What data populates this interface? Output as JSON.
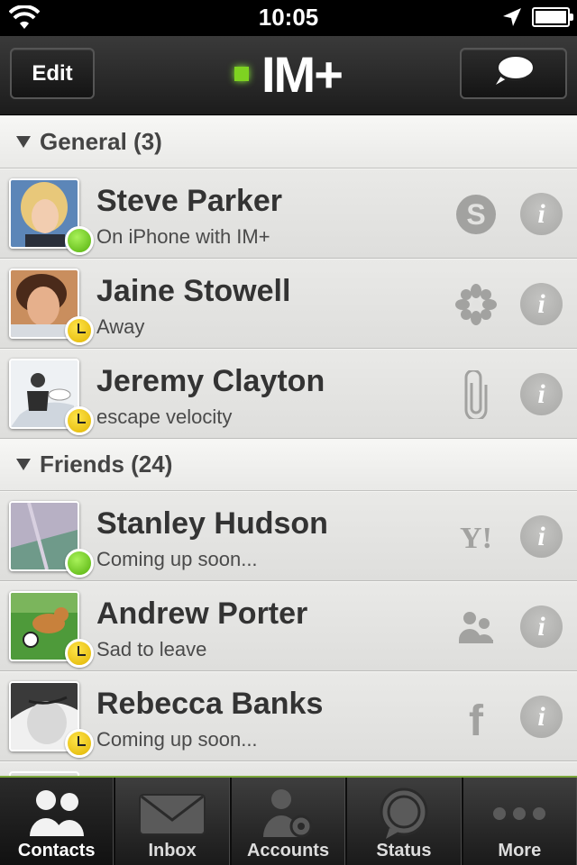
{
  "status_bar": {
    "time": "10:05",
    "icons": [
      "wifi-icon",
      "location-arrow-icon",
      "battery-icon"
    ]
  },
  "nav": {
    "edit_label": "Edit",
    "title": "IM+",
    "compose_icon": "speech-bubble-icon",
    "online_color": "#7ed321"
  },
  "groups": [
    {
      "header": "General (3)",
      "contacts": [
        {
          "name": "Steve Parker",
          "status": "On iPhone with IM+",
          "presence": "online",
          "service": "skype-icon"
        },
        {
          "name": "Jaine Stowell",
          "status": "Away",
          "presence": "away",
          "service": "icq-flower-icon"
        },
        {
          "name": "Jeremy Clayton",
          "status": "escape velocity",
          "presence": "away",
          "service": "paperclip-icon"
        }
      ]
    },
    {
      "header": "Friends (24)",
      "contacts": [
        {
          "name": "Stanley Hudson",
          "status": "Coming up soon...",
          "presence": "online",
          "service": "yahoo-icon"
        },
        {
          "name": "Andrew Porter",
          "status": "Sad to leave",
          "presence": "away",
          "service": "people-group-icon"
        },
        {
          "name": "Rebecca Banks",
          "status": "Coming up soon...",
          "presence": "away",
          "service": "facebook-icon"
        }
      ]
    }
  ],
  "tabs": [
    {
      "label": "Contacts",
      "icon": "contacts-icon",
      "active": true
    },
    {
      "label": "Inbox",
      "icon": "envelope-icon",
      "active": false
    },
    {
      "label": "Accounts",
      "icon": "accounts-gear-icon",
      "active": false
    },
    {
      "label": "Status",
      "icon": "status-bubble-icon",
      "active": false
    },
    {
      "label": "More",
      "icon": "more-dots-icon",
      "active": false
    }
  ],
  "colors": {
    "online": "#7ed321",
    "away": "#f2c200",
    "tab_accent": "#7aa63a"
  }
}
